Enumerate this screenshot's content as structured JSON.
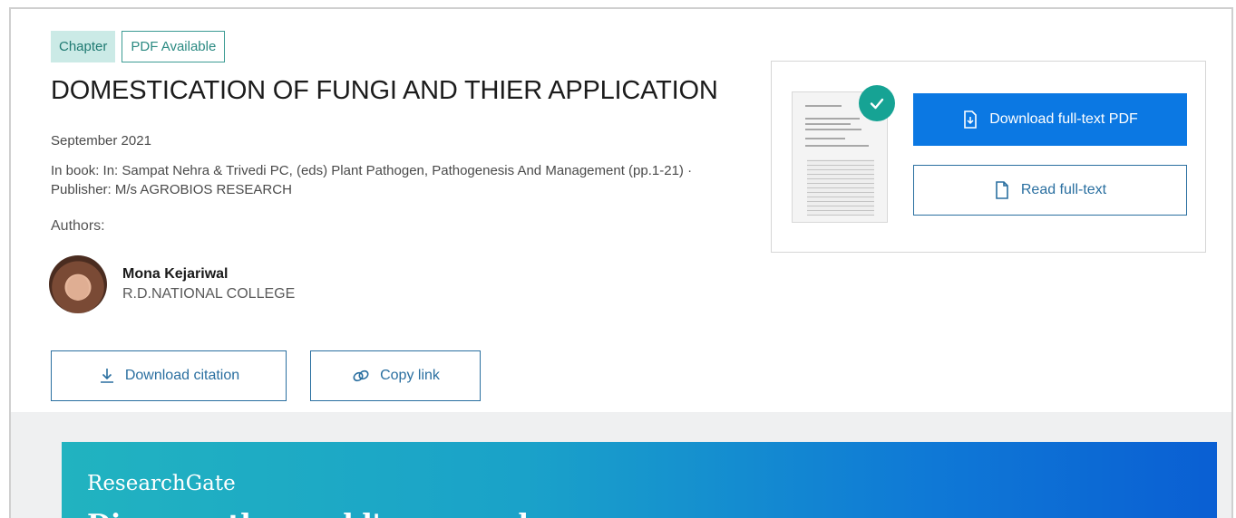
{
  "publication": {
    "type_badge": "Chapter",
    "availability_badge": "PDF Available",
    "title": "DOMESTICATION OF FUNGI AND THIER APPLICATION",
    "date": "September 2021",
    "book_info": "In book: In: Sampat Nehra & Trivedi PC, (eds) Plant Pathogen, Pathogenesis And Management (pp.1-21) · Publisher: M/s AGROBIOS RESEARCH",
    "authors_label": "Authors:",
    "authors": [
      {
        "name": "Mona Kejariwal",
        "affiliation": "R.D.NATIONAL COLLEGE"
      }
    ]
  },
  "actions": {
    "download_citation": "Download citation",
    "copy_link": "Copy link"
  },
  "pdf_panel": {
    "download_pdf": "Download full-text PDF",
    "read_fulltext": "Read full-text"
  },
  "promo": {
    "brand": "ResearchGate",
    "headline": "Discover the world's research"
  },
  "colors": {
    "primary_blue": "#0b78e3",
    "outline_blue": "#2a6fa0",
    "teal": "#16a394",
    "badge_bg": "#cbeae6"
  },
  "icons": [
    "download-icon",
    "link-icon",
    "file-download-icon",
    "file-icon",
    "check-icon"
  ]
}
